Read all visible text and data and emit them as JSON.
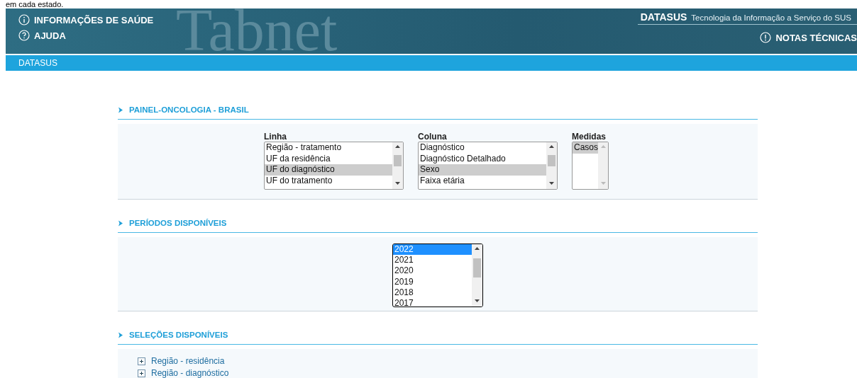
{
  "caption": "em cada estado.",
  "header": {
    "logo": "Tabnet",
    "links_left": [
      {
        "kind": "info",
        "label": "INFORMAÇÕES DE SAÚDE"
      },
      {
        "kind": "help",
        "label": "AJUDA"
      }
    ],
    "brand": "DATASUS",
    "tagline": "Tecnologia da Informação a Serviço do SUS",
    "links_right": [
      {
        "kind": "notice",
        "label": "NOTAS TÉCNICAS"
      }
    ]
  },
  "nav_bar": {
    "label": "DATASUS"
  },
  "sections": [
    {
      "kind": "selectors",
      "title": "PAINEL-ONCOLOGIA - BRASIL",
      "lists": [
        {
          "label": "Linha",
          "items": [
            {
              "label": "Região - tratamento",
              "selected": false
            },
            {
              "label": "UF da residência",
              "selected": false
            },
            {
              "label": "UF do diagnóstico",
              "selected": true
            },
            {
              "label": "UF do tratamento",
              "selected": false
            }
          ]
        },
        {
          "label": "Coluna",
          "items": [
            {
              "label": "Diagnóstico",
              "selected": false
            },
            {
              "label": "Diagnóstico Detalhado",
              "selected": false
            },
            {
              "label": "Sexo",
              "selected": true
            },
            {
              "label": "Faixa etária",
              "selected": false
            }
          ]
        },
        {
          "label": "Medidas",
          "items": [
            {
              "label": "Casos",
              "selected": true
            }
          ]
        }
      ]
    },
    {
      "kind": "periods",
      "title": "PERÍODOS DISPONÍVEIS",
      "items": [
        {
          "label": "2022",
          "selected": true
        },
        {
          "label": "2021",
          "selected": false
        },
        {
          "label": "2020",
          "selected": false
        },
        {
          "label": "2019",
          "selected": false
        },
        {
          "label": "2018",
          "selected": false
        },
        {
          "label": "2017",
          "selected": false
        }
      ]
    },
    {
      "kind": "tree",
      "title": "SELEÇÕES DISPONÍVEIS",
      "items": [
        {
          "label": "Região - residência",
          "expanded": false
        },
        {
          "label": "Região - diagnóstico",
          "expanded": false
        }
      ]
    }
  ]
}
